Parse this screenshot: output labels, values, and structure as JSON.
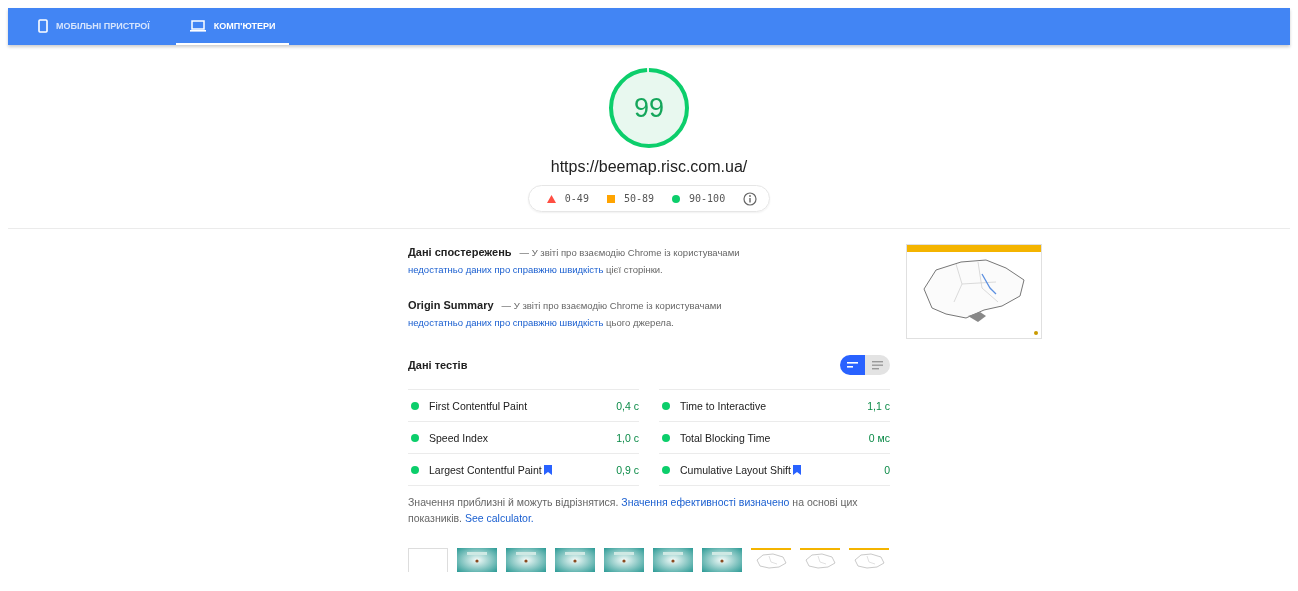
{
  "tabs": [
    {
      "label": "МОБІЛЬНІ ПРИСТРОЇ",
      "selected": false
    },
    {
      "label": "КОМП'ЮТЕРИ",
      "selected": true
    }
  ],
  "score": {
    "value": "99",
    "level": 0.99
  },
  "url": "https://beemap.risc.com.ua/",
  "legend": [
    {
      "kind": "fail",
      "range": "0-49"
    },
    {
      "kind": "average",
      "range": "50-89"
    },
    {
      "kind": "pass",
      "range": "90-100"
    }
  ],
  "field_data": [
    {
      "title": "Дані спостережень",
      "text": "— У звіті про взаємодію Chrome із користувачами",
      "link": "недостатньо даних про справжню швидкість",
      "text_after": "цієї сторінки."
    },
    {
      "title": "Origin Summary",
      "text": "— У звіті про взаємодію Chrome із користувачами",
      "link": "недостатньо даних про справжню швидкість",
      "text_after": "цього джерела."
    }
  ],
  "lab": {
    "title": "Дані тестів",
    "view_toggle": [
      {
        "selected": true
      },
      {
        "selected": false
      }
    ],
    "metrics": [
      {
        "name": "First Contentful Paint",
        "value": "0,4 с",
        "color": "#0cce6b",
        "bookmark": false
      },
      {
        "name": "Time to Interactive",
        "value": "1,1 с",
        "color": "#0cce6b",
        "bookmark": false
      },
      {
        "name": "Speed Index",
        "value": "1,0 с",
        "color": "#0cce6b",
        "bookmark": false
      },
      {
        "name": "Total Blocking Time",
        "value": "0 мс",
        "color": "#0cce6b",
        "bookmark": false
      },
      {
        "name": "Largest Contentful Paint",
        "value": "0,9 с",
        "color": "#0cce6b",
        "bookmark": true
      },
      {
        "name": "Cumulative Layout Shift",
        "value": "0",
        "color": "#0cce6b",
        "bookmark": true
      }
    ],
    "note": {
      "text": "Значення приблизні й можуть відрізнятися.",
      "link": "Значення ефективності визначено",
      "text_mid": "на основі цих показників.",
      "link_2": "See calculator."
    }
  },
  "filmstrip": [
    {
      "kind": "blank"
    },
    {
      "kind": "splash"
    },
    {
      "kind": "splash"
    },
    {
      "kind": "splash"
    },
    {
      "kind": "splash"
    },
    {
      "kind": "splash"
    },
    {
      "kind": "splash"
    },
    {
      "kind": "map"
    },
    {
      "kind": "map"
    },
    {
      "kind": "map"
    }
  ]
}
